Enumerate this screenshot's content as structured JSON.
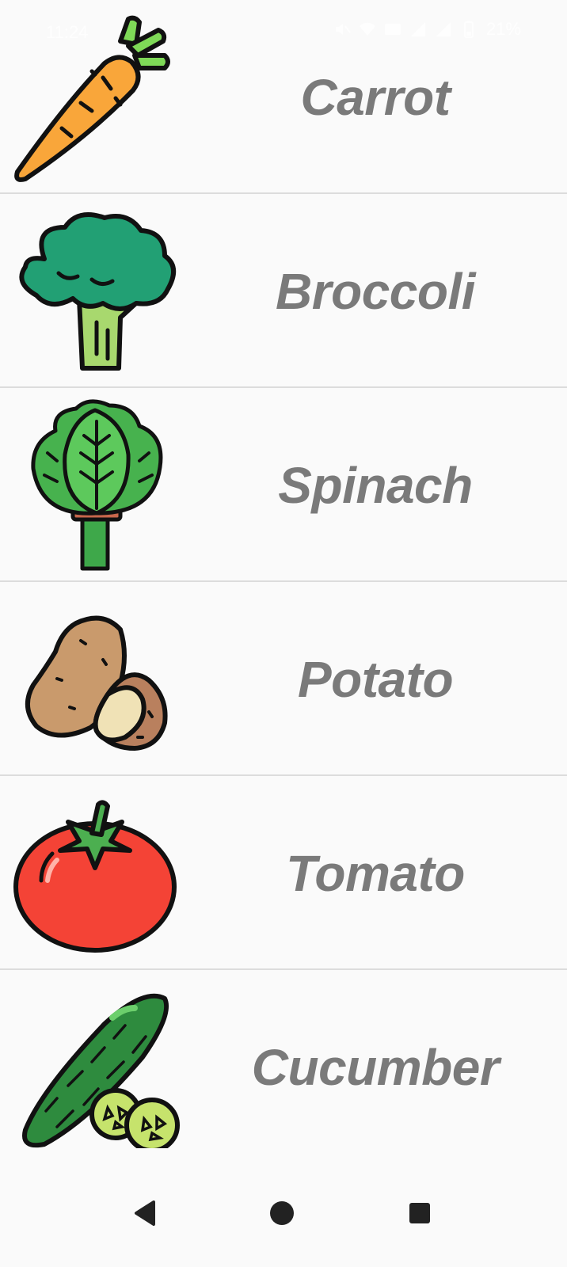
{
  "status_bar": {
    "time": "11:24",
    "battery": "21%"
  },
  "vegetables": [
    {
      "name": "Carrot",
      "icon": "carrot-icon"
    },
    {
      "name": "Broccoli",
      "icon": "broccoli-icon"
    },
    {
      "name": "Spinach",
      "icon": "spinach-icon"
    },
    {
      "name": "Potato",
      "icon": "potato-icon"
    },
    {
      "name": "Tomato",
      "icon": "tomato-icon"
    },
    {
      "name": "Cucumber",
      "icon": "cucumber-icon"
    }
  ],
  "nav_bar": {
    "back": "back-icon",
    "home": "home-icon",
    "recents": "recents-icon"
  },
  "colors": {
    "background": "#fafafa",
    "label": "#7a7a7a",
    "divider": "#dcdcdc",
    "nav_icon": "#222222"
  }
}
